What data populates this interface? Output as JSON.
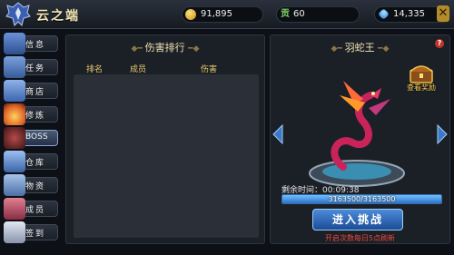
{
  "header": {
    "guild_name": "云之端",
    "gold": "91,895",
    "contribution_label": "贡",
    "contribution": "60",
    "gems": "14,335",
    "add_icon": "plus-icon",
    "close_icon": "close-icon"
  },
  "sidebar": {
    "items": [
      {
        "label": "信息",
        "icon": "book-icon",
        "color": "#4f79c3"
      },
      {
        "label": "任务",
        "icon": "scroll-icon",
        "color": "#4f79c3"
      },
      {
        "label": "商店",
        "icon": "shop-icon",
        "color": "#4f79c3"
      },
      {
        "label": "修炼",
        "icon": "flame-icon",
        "color": "#e0642a"
      },
      {
        "label": "BOSS",
        "icon": "boss-icon",
        "color": "#7a2f2f",
        "active": true
      },
      {
        "label": "仓库",
        "icon": "warehouse-icon",
        "color": "#4f79c3"
      },
      {
        "label": "物资",
        "icon": "supplies-icon",
        "color": "#4f79c3"
      },
      {
        "label": "成员",
        "icon": "members-icon",
        "color": "#c84d63"
      },
      {
        "label": "签到",
        "icon": "checkin-icon",
        "color": "#4f79c3"
      }
    ]
  },
  "ranking": {
    "title": "伤害排行",
    "columns": [
      "排名",
      "成员",
      "伤害"
    ],
    "rows": []
  },
  "boss": {
    "name": "羽蛇王",
    "chest_label": "查看奖励",
    "timer_label": "剩余时间：",
    "timer_value": "00:09:38",
    "hp_current": 3163500,
    "hp_max": 3163500,
    "hp_text": "3163500/3163500",
    "challenge_label": "进入挑战",
    "refresh_note": "开启次数每日5点刷新",
    "help_icon": "help-icon"
  },
  "colors": {
    "accent_gold": "#f0e3b4",
    "hp_blue": "#2e72c8",
    "warning_red": "#e84b3f"
  }
}
